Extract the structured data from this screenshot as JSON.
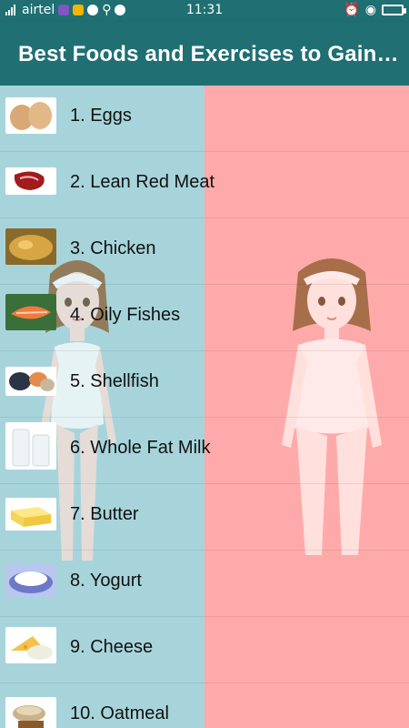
{
  "status_bar": {
    "carrier": "airtel",
    "time": "11:31",
    "signal_icon": "signal-icon",
    "battery_icon": "battery-icon"
  },
  "app_bar": {
    "title": "Best Foods and Exercises to Gain…"
  },
  "foods": [
    {
      "label": "1. Eggs",
      "icon": "eggs-icon"
    },
    {
      "label": "2. Lean Red Meat",
      "icon": "red-meat-icon"
    },
    {
      "label": "3. Chicken",
      "icon": "chicken-icon"
    },
    {
      "label": "4. Oily Fishes",
      "icon": "fish-icon"
    },
    {
      "label": "5. Shellfish",
      "icon": "shellfish-icon"
    },
    {
      "label": "6. Whole Fat Milk",
      "icon": "milk-icon"
    },
    {
      "label": "7. Butter",
      "icon": "butter-icon"
    },
    {
      "label": "8. Yogurt",
      "icon": "yogurt-icon"
    },
    {
      "label": "9. Cheese",
      "icon": "cheese-icon"
    },
    {
      "label": "10. Oatmeal",
      "icon": "oatmeal-icon"
    }
  ],
  "colors": {
    "app_bar": "#1f6f73",
    "left_panel": "#a7d4db",
    "right_panel": "#ffaaaa"
  }
}
